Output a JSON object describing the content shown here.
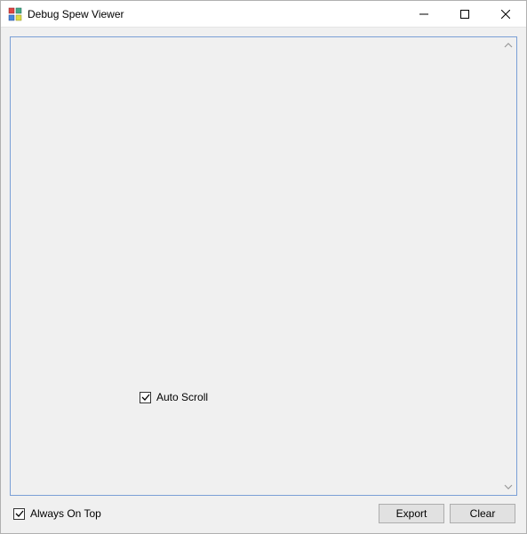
{
  "window": {
    "title": "Debug Spew Viewer"
  },
  "viewer": {
    "content": ""
  },
  "checkboxes": {
    "auto_scroll_label": "Auto Scroll",
    "auto_scroll_checked": true,
    "always_on_top_label": "Always On Top",
    "always_on_top_checked": true
  },
  "buttons": {
    "export_label": "Export",
    "clear_label": "Clear"
  },
  "icons": {
    "app": "app-icon",
    "minimize": "minimize-icon",
    "maximize": "maximize-icon",
    "close": "close-icon",
    "scroll_up": "chevron-up-icon",
    "scroll_down": "chevron-down-icon"
  }
}
